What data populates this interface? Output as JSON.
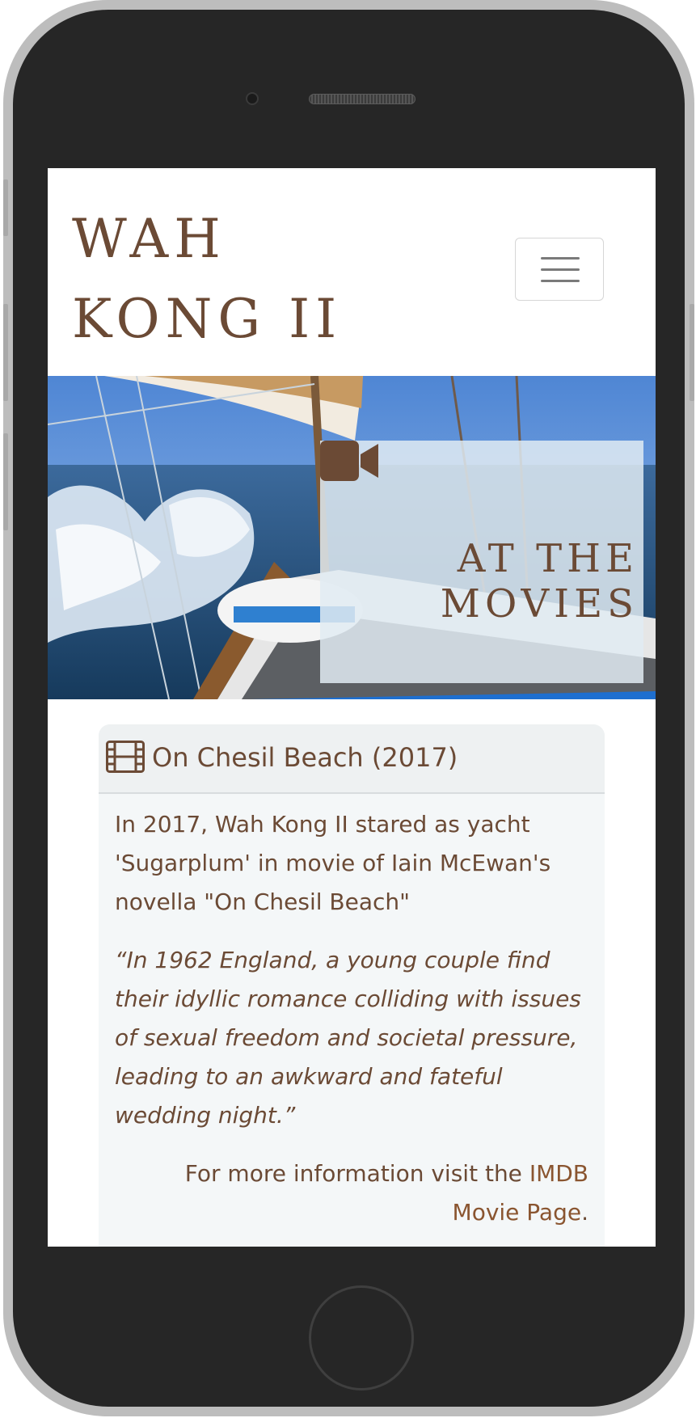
{
  "site": {
    "brand_line1": "WAH",
    "brand_line2": "KONG II"
  },
  "navbar": {
    "toggler_icon": "hamburger-menu-icon"
  },
  "hero": {
    "icon": "video-camera-icon",
    "title_line1": "AT THE",
    "title_line2": "MOVIES"
  },
  "card": {
    "icon": "film-icon",
    "title": "On Chesil Beach (2017)",
    "text": "In 2017, Wah Kong II stared as yacht 'Sugarplum' in movie of Iain McEwan's novella \"On Chesil Beach\"",
    "quote": "“In 1962 England, a young couple find their idyllic romance colliding with issues of sexual freedom and societal pressure, leading to an awkward and fateful wedding night.”",
    "more_prefix": "For more information visit the ",
    "more_link": "IMDB Movie Page",
    "more_suffix": "."
  },
  "colors": {
    "brand_brown": "#6b4a35",
    "link_brown": "#8a5530",
    "card_background": "#f4f7f8",
    "phone_frame": "#262626"
  }
}
